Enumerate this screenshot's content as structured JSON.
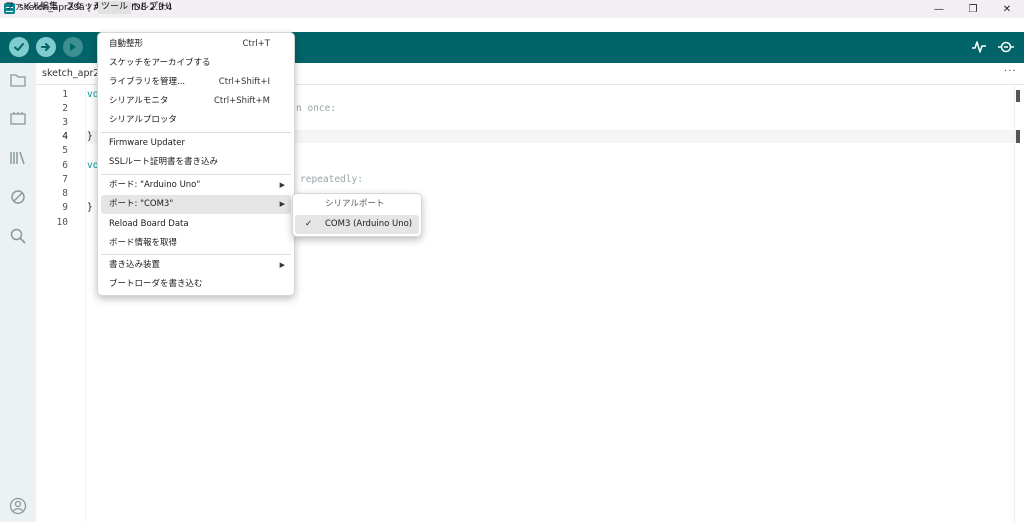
{
  "window": {
    "title": "sketch_apr29a | Arduino IDE 2.3.4",
    "controls": {
      "minimize": "—",
      "maximize": "❐",
      "close": "✕"
    }
  },
  "menubar": {
    "items": [
      {
        "label": "ファイル"
      },
      {
        "label": "編集"
      },
      {
        "label": "スケッチ"
      },
      {
        "label": "ツール"
      },
      {
        "label": "ヘルプ(H)"
      }
    ]
  },
  "toolbar": {
    "buttons": [
      "verify-icon",
      "upload-icon",
      "debug-icon"
    ],
    "right_icons": [
      "serial-plotter-icon",
      "serial-monitor-icon"
    ]
  },
  "sidebar": {
    "icons": [
      "sketchbook-icon",
      "boards-manager-icon",
      "library-manager-icon",
      "debug-icon",
      "search-icon",
      "account-icon"
    ]
  },
  "editor": {
    "tab_label": "sketch_apr29",
    "more": "···",
    "line_numbers": [
      "1",
      "2",
      "3",
      "4",
      "5",
      "6",
      "7",
      "8",
      "9",
      "10"
    ],
    "code_fragments": {
      "l1": "vo",
      "l2": "n once:",
      "l4": "}",
      "l6": "vo",
      "l7": "repeatedly:",
      "l9": "}"
    }
  },
  "tools_menu": {
    "items": [
      {
        "label": "自動整形",
        "shortcut": "Ctrl+T"
      },
      {
        "label": "スケッチをアーカイブする",
        "shortcut": ""
      },
      {
        "label": "ライブラリを管理...",
        "shortcut": "Ctrl+Shift+I"
      },
      {
        "label": "シリアルモニタ",
        "shortcut": "Ctrl+Shift+M"
      },
      {
        "label": "シリアルプロッタ",
        "shortcut": ""
      },
      {
        "label": "Firmware Updater",
        "shortcut": ""
      },
      {
        "label": "SSLルート証明書を書き込み",
        "shortcut": ""
      },
      {
        "label": "ボード: \"Arduino Uno\"",
        "submenu": "▶"
      },
      {
        "label": "ポート: \"COM3\"",
        "submenu": "▶"
      },
      {
        "label": "Reload Board Data",
        "shortcut": ""
      },
      {
        "label": "ボード情報を取得",
        "shortcut": ""
      },
      {
        "label": "書き込み装置",
        "submenu": "▶"
      },
      {
        "label": "ブートローダを書き込む",
        "shortcut": ""
      }
    ]
  },
  "port_submenu": {
    "header": "シリアルポート",
    "items": [
      {
        "label": "COM3 (Arduino Uno)",
        "checked": "✓"
      }
    ]
  },
  "colors": {
    "toolbar": "#006468",
    "toolbar_button": "#7fcbcd",
    "keyword": "#00979c"
  }
}
